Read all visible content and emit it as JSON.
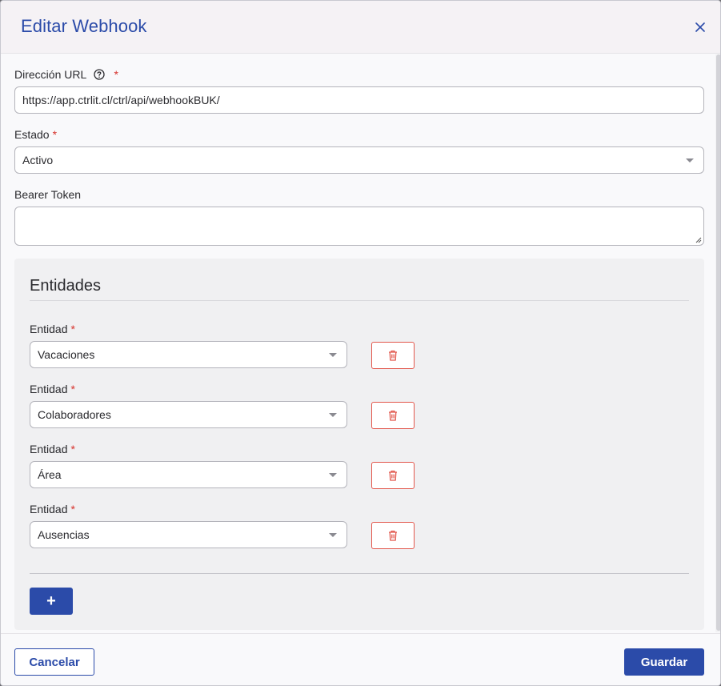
{
  "dialog": {
    "title": "Editar Webhook",
    "close_icon": "close-icon"
  },
  "fields": {
    "url_label": "Dirección URL",
    "url_value": "https://app.ctrlit.cl/ctrl/api/webhookBUK/",
    "estado_label": "Estado",
    "estado_value": "Activo",
    "token_label": "Bearer Token",
    "token_value": "",
    "required_mark": "*"
  },
  "entities": {
    "title": "Entidades",
    "items": [
      {
        "label": "Entidad",
        "value": "Vacaciones"
      },
      {
        "label": "Entidad",
        "value": "Colaboradores"
      },
      {
        "label": "Entidad",
        "value": "Área"
      },
      {
        "label": "Entidad",
        "value": "Ausencias"
      }
    ],
    "add_label": "+"
  },
  "footer": {
    "cancel_label": "Cancelar",
    "save_label": "Guardar"
  },
  "colors": {
    "accent": "#2b4ba9",
    "danger": "#e2574c",
    "required": "#d6322c"
  }
}
